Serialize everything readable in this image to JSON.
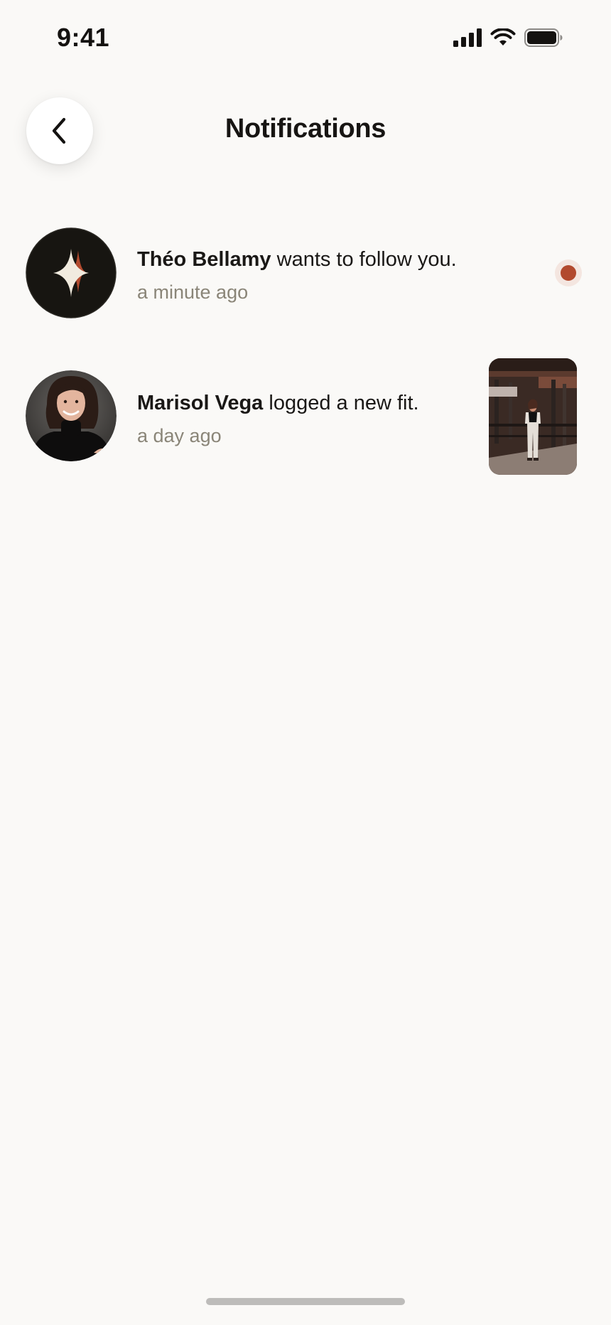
{
  "status_bar": {
    "time": "9:41",
    "icons": [
      "cellular-signal-icon",
      "wifi-icon",
      "battery-icon"
    ]
  },
  "header": {
    "title": "Notifications",
    "back_icon": "chevron-left-icon"
  },
  "notifications": [
    {
      "actor": "Théo Bellamy",
      "action": "wants to follow you.",
      "time": "a minute ago",
      "unread": true,
      "avatar_icon": "sparkle-logo-icon"
    },
    {
      "actor": "Marisol Vega",
      "action": "logged a new fit.",
      "time": "a day ago",
      "unread": false,
      "avatar_icon": "profile-photo",
      "thumbnail": "outfit-photo"
    }
  ],
  "colors": {
    "background": "#faf9f7",
    "accent": "#b24a2e",
    "secondary_text": "#8a8578"
  }
}
